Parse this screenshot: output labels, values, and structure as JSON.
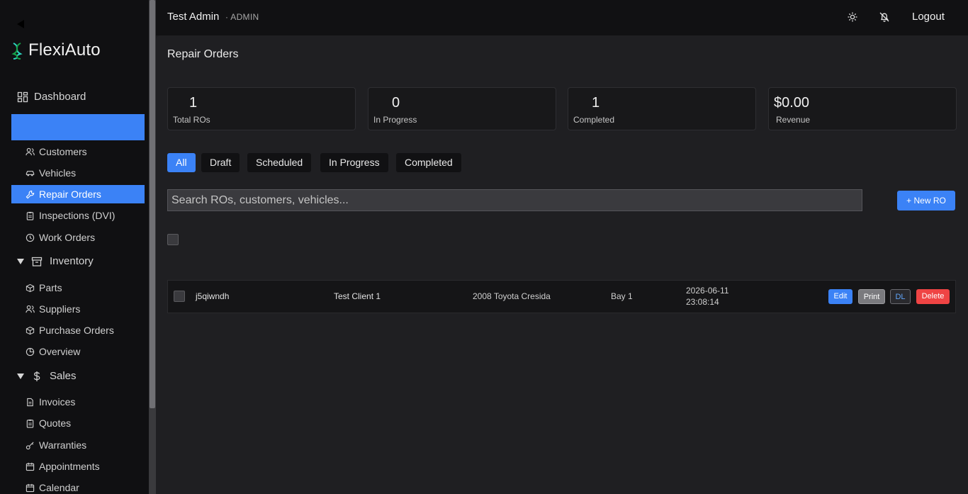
{
  "sidebar": {
    "brand": "FlexiAuto",
    "dashboard": "Dashboard",
    "items_top": [
      {
        "label": "Customers",
        "icon": "users-icon"
      },
      {
        "label": "Vehicles",
        "icon": "car-icon"
      },
      {
        "label": "Repair Orders",
        "icon": "wrench-icon",
        "active": true
      },
      {
        "label": "Inspections (DVI)",
        "icon": "clipboard-icon"
      },
      {
        "label": "Work Orders",
        "icon": "clock-icon"
      }
    ],
    "inventory": {
      "label": "Inventory",
      "items": [
        {
          "label": "Parts",
          "icon": "box-icon"
        },
        {
          "label": "Suppliers",
          "icon": "users-icon"
        },
        {
          "label": "Purchase Orders",
          "icon": "box-icon"
        },
        {
          "label": "Overview",
          "icon": "pie-chart-icon"
        }
      ]
    },
    "sales": {
      "label": "Sales",
      "items": [
        {
          "label": "Invoices",
          "icon": "document-icon"
        },
        {
          "label": "Quotes",
          "icon": "clipboard-icon"
        },
        {
          "label": "Warranties",
          "icon": "key-icon"
        },
        {
          "label": "Appointments",
          "icon": "calendar-icon"
        },
        {
          "label": "Calendar",
          "icon": "calendar-icon"
        }
      ]
    }
  },
  "header": {
    "user": "Test Admin",
    "role": "· ADMIN",
    "logout": "Logout"
  },
  "main": {
    "title": "Repair Orders",
    "stats": [
      {
        "value": "1",
        "label": "Total ROs"
      },
      {
        "value": "0",
        "label": "In Progress"
      },
      {
        "value": "1",
        "label": "Completed"
      },
      {
        "value": "$0.00",
        "label": "Revenue"
      }
    ],
    "tabs": [
      "All",
      "Draft",
      "Scheduled",
      "In Progress",
      "Completed"
    ],
    "active_tab": "All",
    "search_placeholder": "Search ROs, customers, vehicles...",
    "new_button": "+ New RO",
    "rows": [
      {
        "ro": "j5qiwndh",
        "customer": "Test Client 1",
        "vehicle": "2008 Toyota Cresida",
        "bay": "Bay 1",
        "date": "2026-06-11",
        "time": "23:08:14",
        "actions": {
          "edit": "Edit",
          "print": "Print",
          "dl": "DL",
          "delete": "Delete"
        }
      }
    ]
  },
  "colors": {
    "accent": "#3b82f6",
    "danger": "#ef4444",
    "print": "#7a7a7e",
    "brand_icon": "#2dd4bf"
  }
}
